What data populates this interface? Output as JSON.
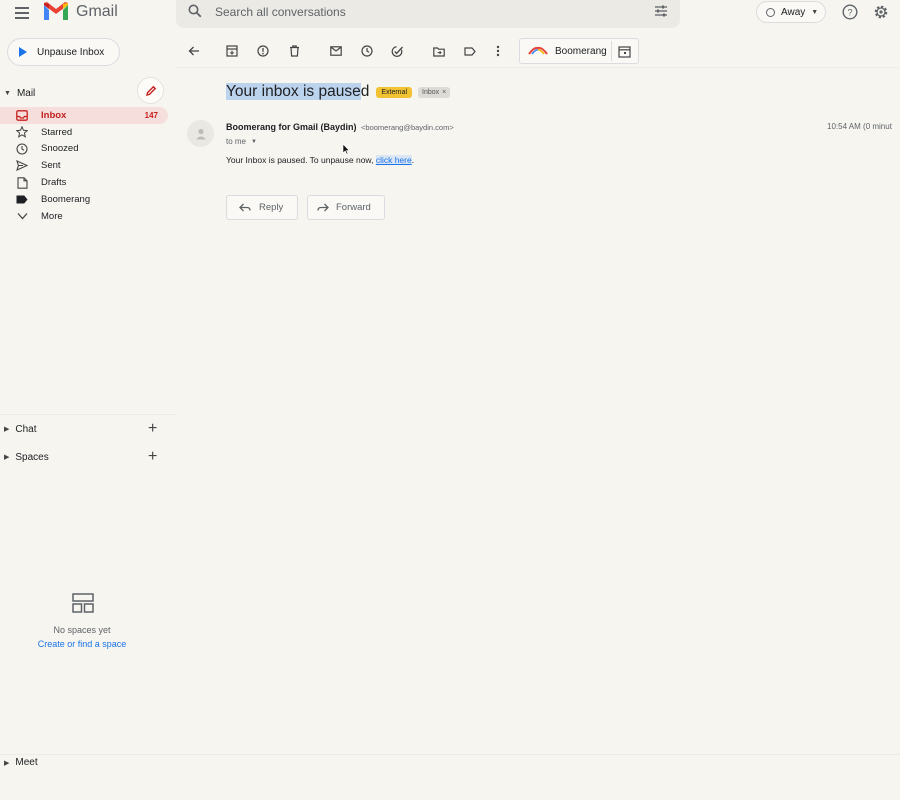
{
  "app": {
    "name": "Gmail"
  },
  "search": {
    "placeholder": "Search all conversations"
  },
  "status": {
    "label": "Away"
  },
  "sidebar": {
    "unpause_label": "Unpause Inbox",
    "mail_section": "Mail",
    "items": [
      {
        "label": "Inbox",
        "count": "147",
        "icon": "inbox-icon",
        "active": true
      },
      {
        "label": "Starred",
        "count": "",
        "icon": "star-icon"
      },
      {
        "label": "Snoozed",
        "count": "",
        "icon": "clock-icon"
      },
      {
        "label": "Sent",
        "count": "",
        "icon": "send-icon"
      },
      {
        "label": "Drafts",
        "count": "",
        "icon": "draft-icon"
      },
      {
        "label": "Boomerang",
        "count": "",
        "icon": "label-icon"
      },
      {
        "label": "More",
        "count": "",
        "icon": "chevron-down-icon"
      }
    ],
    "chat_section": "Chat",
    "spaces_section": "Spaces",
    "no_spaces_text": "No spaces yet",
    "find_space_link": "Create or find a space",
    "meet_section": "Meet"
  },
  "toolbar": {
    "boomerang_label": "Boomerang"
  },
  "message": {
    "subject_selected": "Your inbox is pause",
    "subject_rest": "d",
    "labels": {
      "external": "External",
      "inbox": "Inbox"
    },
    "sender_name": "Boomerang for Gmail (Baydin)",
    "sender_email": "<boomerang@baydin.com>",
    "to": "to me",
    "time": "10:54 AM (0 minut",
    "body_text": "Your Inbox is paused. To unpause now, ",
    "body_link": "click here",
    "body_end": ".",
    "reply_label": "Reply",
    "forward_label": "Forward"
  },
  "colors": {
    "accent_red": "#c5221f",
    "active_bg": "#f6dedd",
    "link_blue": "#1a73e8",
    "external_label": "#f1c232"
  }
}
